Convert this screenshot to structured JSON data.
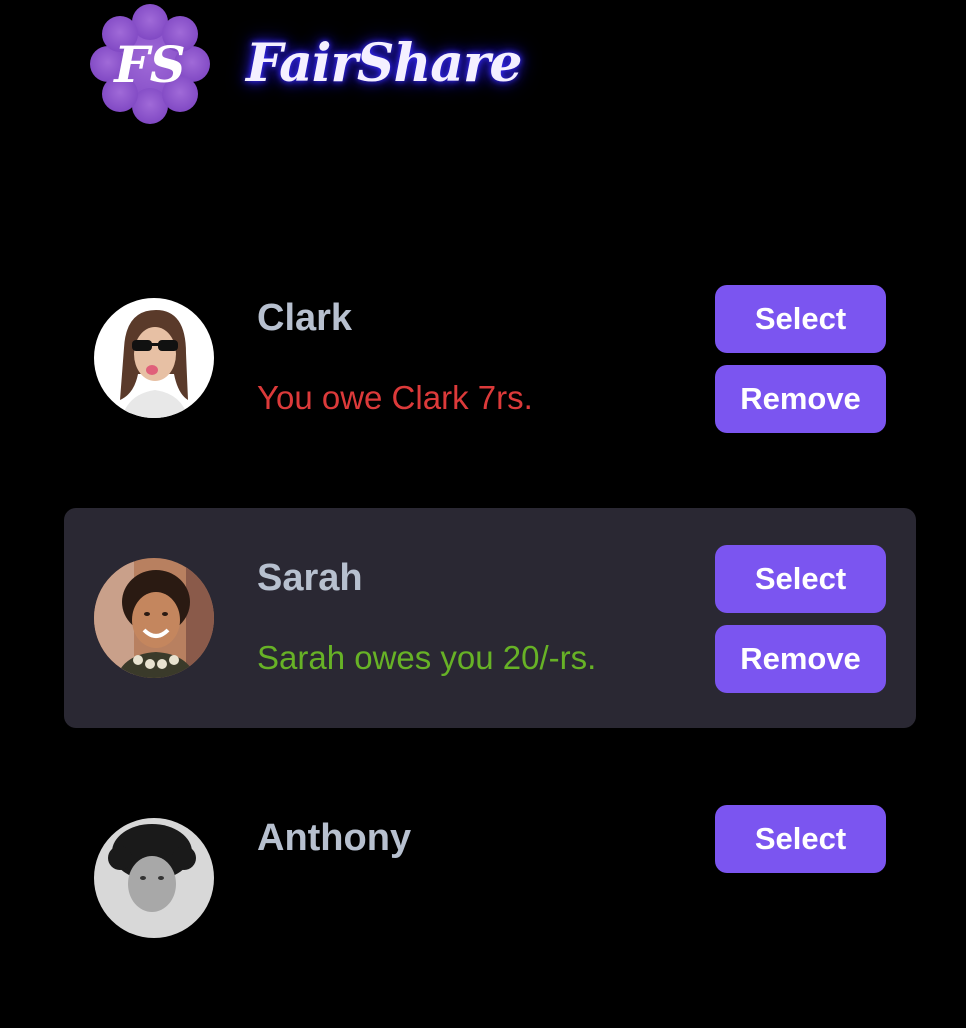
{
  "app": {
    "logo_text": "FS",
    "name": "FairShare",
    "colors": {
      "background": "#000000",
      "selected_row": "#2a2833",
      "button": "#7b55f0",
      "owe": "#dc3a3a",
      "owed": "#67b226",
      "name_text": "#b7c0cf"
    }
  },
  "friends": [
    {
      "name": "Clark",
      "balance": "You owe Clark 7rs.",
      "balance_type": "owe",
      "select_label": "Select",
      "remove_label": "Remove",
      "selected": false
    },
    {
      "name": "Sarah",
      "balance": "Sarah owes you 20/-rs.",
      "balance_type": "owed",
      "select_label": "Select",
      "remove_label": "Remove",
      "selected": true
    },
    {
      "name": "Anthony",
      "balance": "",
      "balance_type": "",
      "select_label": "Select",
      "remove_label": "",
      "selected": false
    }
  ]
}
